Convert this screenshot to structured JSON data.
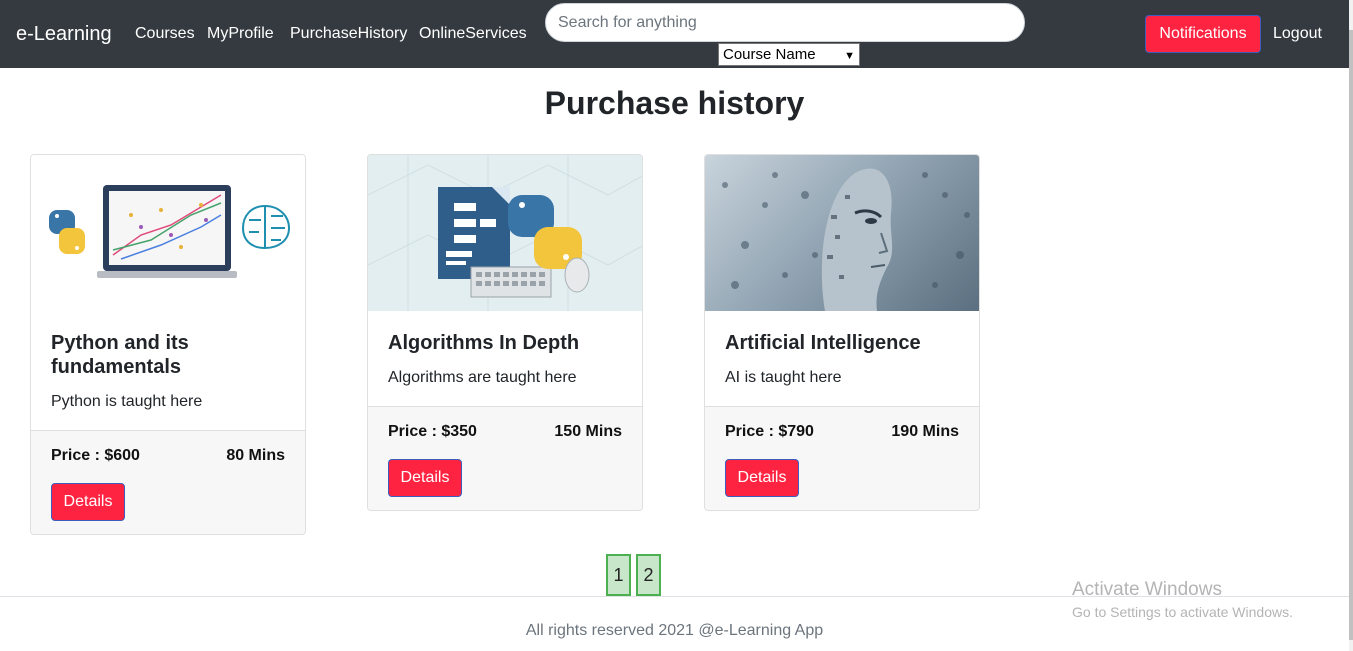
{
  "navbar": {
    "brand": "e-Learning",
    "links": [
      "Courses",
      "MyProfile",
      "PurchaseHistory",
      "OnlineServices"
    ],
    "search_placeholder": "Search for anything",
    "select_value": "Course Name",
    "notifications_label": "Notifications",
    "logout_label": "Logout"
  },
  "page": {
    "title": "Purchase history"
  },
  "cards": [
    {
      "title": "Python and its fundamentals",
      "text": "Python is taught here",
      "price": "Price : $600",
      "duration": "80 Mins",
      "button": "Details",
      "image_icon": "python-ml-laptop-image"
    },
    {
      "title": "Algorithms In Depth",
      "text": "Algorithms are taught here",
      "price": "Price : $350",
      "duration": "150 Mins",
      "button": "Details",
      "image_icon": "flowchart-python-image"
    },
    {
      "title": "Artificial Intelligence",
      "text": "AI is taught here",
      "price": "Price : $790",
      "duration": "190 Mins",
      "button": "Details",
      "image_icon": "ai-face-image"
    }
  ],
  "pagination": [
    "1",
    "2"
  ],
  "footer": {
    "text": "All rights reserved 2021 @e-Learning App"
  },
  "watermark": {
    "line1": "Activate Windows",
    "line2": "Go to Settings to activate Windows."
  },
  "colors": {
    "navbar": "#343a40",
    "accent": "#fe2341",
    "pager_fill": "#c8e6c9",
    "pager_border": "#4caf50"
  }
}
